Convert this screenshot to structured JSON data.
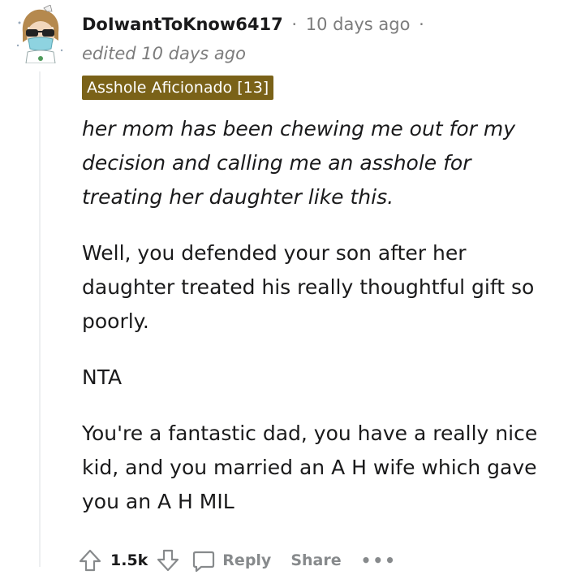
{
  "comment": {
    "author": "DoIwantToKnow6417",
    "time": "10 days ago",
    "edited": "edited 10 days ago",
    "flair": "Asshole Aficionado [13]",
    "paragraphs": [
      "her mom has been chewing me out for my decision and calling me an asshole for treating her daughter like this.",
      "Well, you defended your son after her daughter treated his really thoughtful gift so poorly.",
      "NTA",
      "You're a fantastic dad, you have a really nice kid, and you married an A H wife which gave you an A H MIL"
    ]
  },
  "actions": {
    "score": "1.5k",
    "reply_label": "Reply",
    "share_label": "Share",
    "more_label": "•••"
  },
  "icons": {
    "upvote": "upvote-icon",
    "downvote": "downvote-icon",
    "reply": "comment-bubble-icon",
    "more": "more-icon"
  }
}
